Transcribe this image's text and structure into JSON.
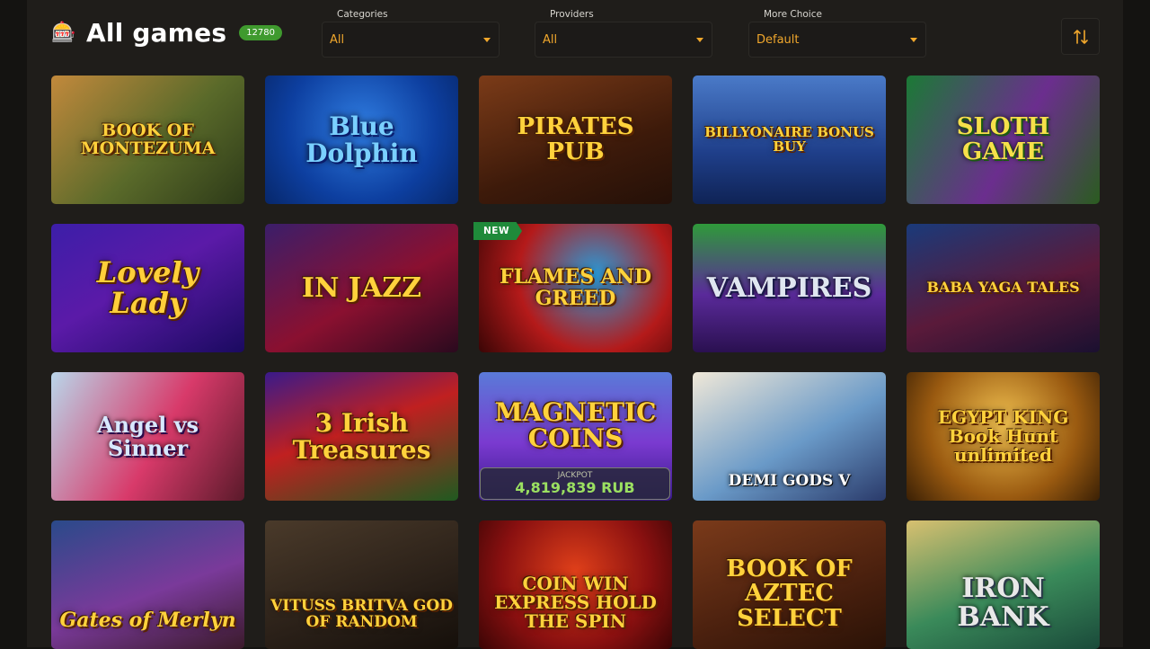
{
  "header": {
    "title": "All games",
    "count": "12780",
    "icon": "slot-machine-icon"
  },
  "filters": [
    {
      "label": "Categories",
      "value": "All"
    },
    {
      "label": "Providers",
      "value": "All"
    },
    {
      "label": "More Choice",
      "value": "Default"
    }
  ],
  "sort_icon": "sort-arrows-icon",
  "colors": {
    "accent": "#f0a72c",
    "badge_green": "#3f9a2e",
    "background": "#1f1d1a"
  },
  "games": [
    {
      "title": "BOOK OF MONTEZUMA"
    },
    {
      "title": "Blue Dolphin"
    },
    {
      "title": "PIRATES PUB"
    },
    {
      "title": "BILLYONAIRE BONUS BUY"
    },
    {
      "title": "SLOTH GAME"
    },
    {
      "title": "Lovely Lady"
    },
    {
      "title": "IN JAZZ"
    },
    {
      "title": "FLAMES AND GREED",
      "badge": "NEW"
    },
    {
      "title": "VAMPIRES"
    },
    {
      "title": "BABA YAGA TALES"
    },
    {
      "title": "Angel vs Sinner"
    },
    {
      "title": "3 Irish Treasures"
    },
    {
      "title": "MAGNETIC COINS",
      "jackpot_label": "JACKPOT",
      "jackpot_value": "4,819,839 RUB"
    },
    {
      "title": "DEMI GODS V"
    },
    {
      "title": "EGYPT KING Book Hunt unlimited"
    },
    {
      "title": "Gates of Merlyn"
    },
    {
      "title": "VITUSS BRITVA GOD OF RANDOM"
    },
    {
      "title": "COIN WIN EXPRESS HOLD THE SPIN"
    },
    {
      "title": "BOOK OF AZTEC SELECT"
    },
    {
      "title": "IRON BANK"
    }
  ]
}
